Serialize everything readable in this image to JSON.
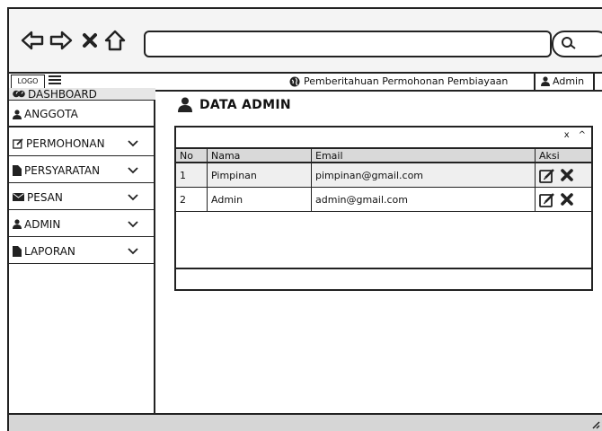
{
  "header": {
    "logo": "LOGO",
    "notification": "Pemberitahuan Permohonan Pembiayaan",
    "user": "Admin"
  },
  "sidebar": {
    "items": [
      {
        "label": "DASHBOARD",
        "icon": "dashboard-icon",
        "active": true
      },
      {
        "label": "ANGGOTA",
        "icon": "user-icon"
      },
      {
        "label": "PERMOHONAN",
        "icon": "edit-icon",
        "chevron": true
      },
      {
        "label": "PERSYARATAN",
        "icon": "file-icon",
        "chevron": true
      },
      {
        "label": "PESAN",
        "icon": "envelope-icon",
        "chevron": true
      },
      {
        "label": "ADMIN",
        "icon": "user-icon",
        "chevron": true
      },
      {
        "label": "LAPORAN",
        "icon": "file-icon",
        "chevron": true
      }
    ]
  },
  "main": {
    "title": "DATA ADMIN",
    "panel_close": "x",
    "panel_collapse": "^",
    "table": {
      "columns": [
        "No",
        "Nama",
        "Email",
        "Aksi"
      ],
      "rows": [
        {
          "no": "1",
          "nama": "Pimpinan",
          "email": "pimpinan@gmail.com"
        },
        {
          "no": "2",
          "nama": "Admin",
          "email": "admin@gmail.com"
        }
      ]
    }
  },
  "colors": {
    "border": "#222222",
    "chrome_bg": "#f4f4f4",
    "active_bg": "#e6e6e6",
    "header_row_bg": "#d9d9d9",
    "footer_bg": "#d6d6d6"
  }
}
